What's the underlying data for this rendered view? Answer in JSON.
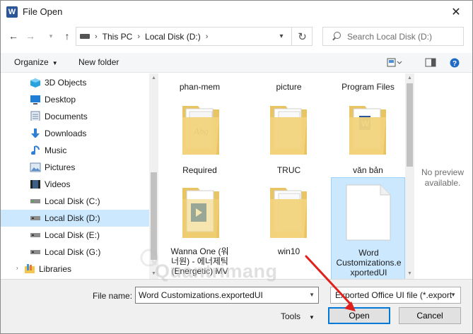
{
  "window": {
    "title": "File Open",
    "app_icon_letter": "W"
  },
  "address_bar": {
    "segments": [
      "This PC",
      "Local Disk (D:)"
    ]
  },
  "search": {
    "placeholder": "Search Local Disk (D:)"
  },
  "toolbar": {
    "organize_label": "Organize",
    "new_folder_label": "New folder"
  },
  "sidebar": {
    "items": [
      {
        "label": "3D Objects",
        "icon": "3d-objects-icon"
      },
      {
        "label": "Desktop",
        "icon": "desktop-icon"
      },
      {
        "label": "Documents",
        "icon": "documents-icon"
      },
      {
        "label": "Downloads",
        "icon": "downloads-icon"
      },
      {
        "label": "Music",
        "icon": "music-icon"
      },
      {
        "label": "Pictures",
        "icon": "pictures-icon"
      },
      {
        "label": "Videos",
        "icon": "videos-icon"
      },
      {
        "label": "Local Disk (C:)",
        "icon": "drive-icon"
      },
      {
        "label": "Local Disk (D:)",
        "icon": "drive-icon",
        "selected": true
      },
      {
        "label": "Local Disk (E:)",
        "icon": "drive-icon"
      },
      {
        "label": "Local Disk (G:)",
        "icon": "drive-icon"
      },
      {
        "label": "Libraries",
        "icon": "libraries-icon"
      }
    ]
  },
  "files": {
    "top_row": [
      "phan-mem",
      "picture",
      "Program Files"
    ],
    "items": [
      {
        "label": "Required",
        "type": "folder"
      },
      {
        "label": "TRUC",
        "type": "folder"
      },
      {
        "label": "văn bản",
        "type": "folder"
      },
      {
        "label_lines": [
          "Wanna One (워",
          "너원) - 에너제틱",
          "(Energetic) MV"
        ],
        "type": "folder"
      },
      {
        "label": "win10",
        "type": "folder"
      },
      {
        "label_lines": [
          "Word",
          "Customizations.e",
          "xportedUI"
        ],
        "type": "file",
        "selected": true
      }
    ]
  },
  "preview": {
    "text_lines": [
      "No preview",
      "available."
    ]
  },
  "bottom": {
    "file_name_label": "File name:",
    "file_name_value": "Word Customizations.exportedUI",
    "file_type_value": "Exported Office UI file (*.export",
    "tools_label": "Tools",
    "open_label": "Open",
    "cancel_label": "Cancel"
  },
  "watermark": {
    "text": "Quantrimang"
  },
  "colors": {
    "selection": "#cce8ff",
    "accent": "#0078d7",
    "annotation_arrow": "#e0201c"
  }
}
